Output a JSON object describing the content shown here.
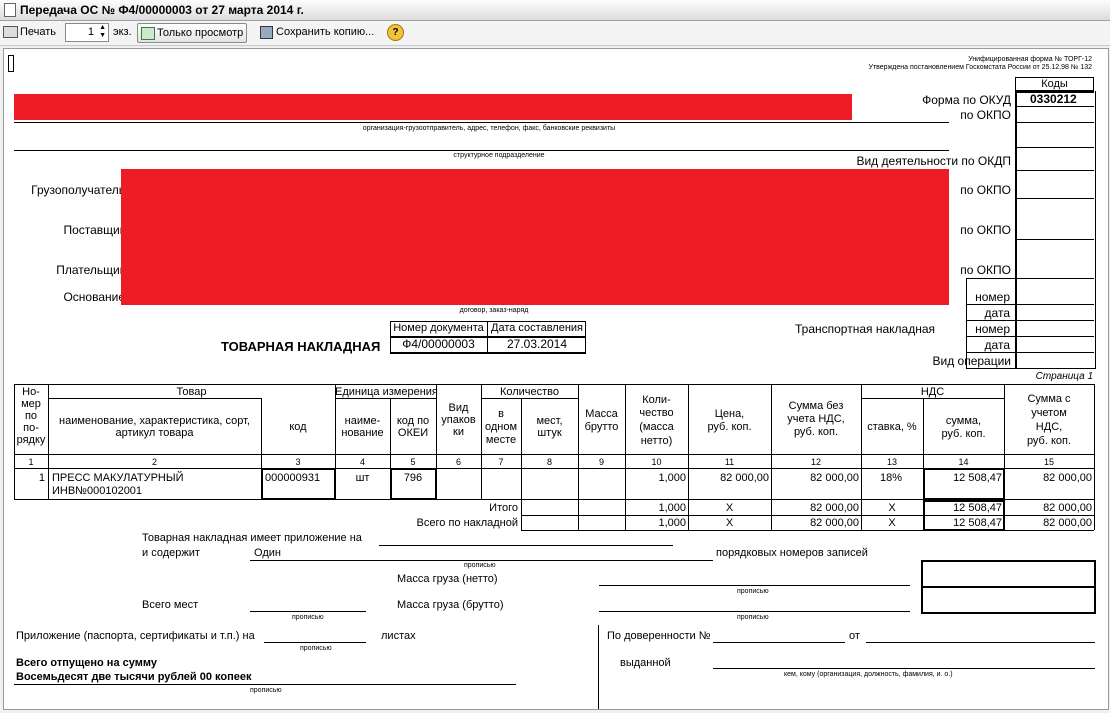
{
  "window": {
    "title": "Передача ОС № Ф4/00000003 от 27 марта 2014 г."
  },
  "toolbar": {
    "print": "Печать",
    "copies_value": "1",
    "copies_suffix": "экз.",
    "view_only": "Только просмотр",
    "save_copy": "Сохранить копию...",
    "help_icon": "?"
  },
  "header": {
    "form_line1": "Унифицированная форма № ТОРГ-12",
    "form_line2": "Утверждена постановлением Госкомстата России от 25.12.98 № 132",
    "codes": "Коды",
    "okud_label": "Форма по ОКУД",
    "okud_value": "0330212",
    "okpo": "по ОКПО",
    "okdp": "Вид деятельности по ОКДП",
    "org_caption": "организация-грузоотправитель, адрес, телефон, факс, банковские реквизиты",
    "dept_caption": "структурное подразделение",
    "consignee": "Грузополучатель",
    "supplier": "Поставщик",
    "payer": "Плательщик",
    "basis": "Основание",
    "basis_caption": "договор, заказ-наряд",
    "number": "номер",
    "date": "дата",
    "transport": "Транспортная накладная",
    "operation": "Вид операции",
    "doc_title": "ТОВАРНАЯ НАКЛАДНАЯ",
    "doc_num_label": "Номер документа",
    "doc_date_label": "Дата составления",
    "doc_num": "Ф4/00000003",
    "doc_date": "27.03.2014",
    "page": "Страница 1"
  },
  "table": {
    "h_rownum": [
      "Но-",
      "мер",
      "по",
      "по-",
      "рядку"
    ],
    "h_goods": "Товар",
    "h_goods_name": [
      "наименование, характеристика, сорт,",
      "артикул товара"
    ],
    "h_code": "код",
    "h_unit": "Единица измерения",
    "h_unit_name": [
      "наиме-",
      "нование"
    ],
    "h_okei": [
      "код по",
      "ОКЕИ"
    ],
    "h_pack": [
      "Вид",
      "упаков",
      "ки"
    ],
    "h_qty": "Количество",
    "h_in_one": [
      "в",
      "одном",
      "месте"
    ],
    "h_places": [
      "мест,",
      "штук"
    ],
    "h_gross": [
      "Масса",
      "брутто"
    ],
    "h_qty_net": [
      "Коли-",
      "чество",
      "(масса",
      "нетто)"
    ],
    "h_price": [
      "Цена,",
      "руб. коп."
    ],
    "h_sum_no_vat": [
      "Сумма без",
      "учета НДС,",
      "руб. коп."
    ],
    "h_vat": "НДС",
    "h_rate": "ставка, %",
    "h_vat_sum": [
      "сумма,",
      "руб. коп."
    ],
    "h_sum_vat": [
      "Сумма с",
      "учетом",
      "НДС,",
      "руб. коп."
    ],
    "col_numbers": [
      "1",
      "2",
      "3",
      "4",
      "5",
      "6",
      "7",
      "8",
      "9",
      "10",
      "11",
      "12",
      "13",
      "14",
      "15"
    ],
    "row": {
      "n": "1",
      "name1": "ПРЕСС МАКУЛАТУРНЫЙ",
      "name2": "ИНВ№000102001",
      "code": "000000931",
      "unit": "шт",
      "okei": "796",
      "qty": "1,000",
      "price": "82 000,00",
      "sum": "82 000,00",
      "rate": "18%",
      "vat": "12 508,47",
      "total": "82 000,00"
    },
    "itogo": {
      "label": "Итого",
      "qty": "1,000",
      "price": "X",
      "sum": "82 000,00",
      "rate": "X",
      "vat": "12 508,47",
      "total": "82 000,00"
    },
    "vsego": {
      "label": "Всего по накладной",
      "qty": "1,000",
      "price": "X",
      "sum": "82 000,00",
      "rate": "X",
      "vat": "12 508,47",
      "total": "82 000,00"
    }
  },
  "footer": {
    "attach1": "Товарная накладная имеет приложение на",
    "attach2": "и содержит",
    "contains_value": "Один",
    "records": "порядковых номеров записей",
    "propisyu": "прописью",
    "net_mass": "Масса груза (нетто)",
    "gross_mass": "Масса груза (брутто)",
    "places_total": "Всего мест",
    "appendix": "Приложение (паспорта, сертификаты и т.п.) на",
    "sheets": "листах",
    "released": "Всего отпущено  на сумму",
    "released_words": "Восемьдесят две тысячи рублей 00 копеек",
    "proxy": "По доверенности №",
    "from": "от",
    "issued": "выданной",
    "issued_caption": "кем, кому (организация, должность, фамилия, и. о.)"
  }
}
